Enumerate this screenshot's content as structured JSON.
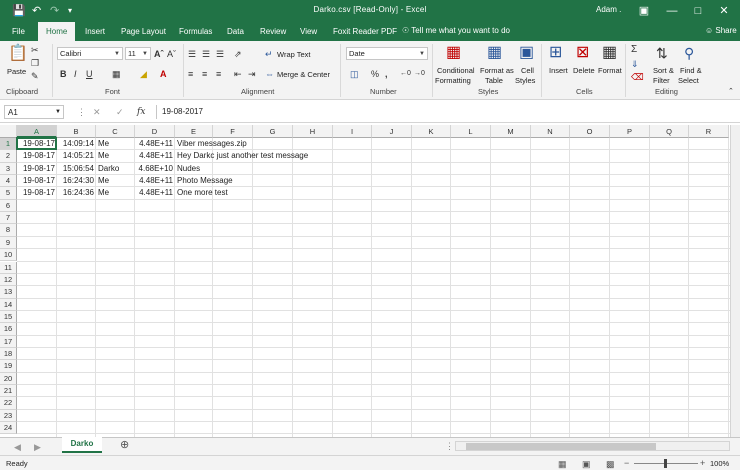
{
  "title_bar": {
    "title": "Darko.csv  [Read-Only]  -  Excel",
    "user": "Adam ."
  },
  "tabs": [
    "File",
    "Home",
    "Insert",
    "Page Layout",
    "Formulas",
    "Data",
    "Review",
    "View",
    "Foxit Reader PDF"
  ],
  "tell_me": "Tell me what you want to do",
  "share": "Share",
  "ribbon": {
    "clipboard": {
      "label": "Clipboard",
      "paste": "Paste"
    },
    "font": {
      "label": "Font",
      "name": "Calibri",
      "size": "11"
    },
    "alignment": {
      "label": "Alignment",
      "wrap": "Wrap Text",
      "merge": "Merge & Center"
    },
    "number": {
      "label": "Number",
      "format": "Date"
    },
    "styles": {
      "label": "Styles",
      "conditional_1": "Conditional",
      "conditional_2": "Formatting",
      "format_as_1": "Format as",
      "format_as_2": "Table",
      "cell_1": "Cell",
      "cell_2": "Styles"
    },
    "cells": {
      "label": "Cells",
      "insert": "Insert",
      "delete": "Delete",
      "format": "Format"
    },
    "editing": {
      "label": "Editing",
      "sort_1": "Sort &",
      "sort_2": "Filter",
      "find_1": "Find &",
      "find_2": "Select"
    }
  },
  "formula_bar": {
    "name_box": "A1",
    "fx": "fx",
    "value": "19-08-2017"
  },
  "columns": [
    "A",
    "B",
    "C",
    "D",
    "E",
    "F",
    "G",
    "H",
    "I",
    "J",
    "K",
    "L",
    "M",
    "N",
    "O",
    "P",
    "Q",
    "R"
  ],
  "rows": [
    "1",
    "2",
    "3",
    "4",
    "5",
    "6",
    "7",
    "8",
    "9",
    "10",
    "11",
    "12",
    "13",
    "14",
    "15",
    "16",
    "17",
    "18",
    "19",
    "20",
    "21",
    "22",
    "23",
    "24"
  ],
  "data": [
    [
      "19-08-17",
      "14:09:14",
      "Me",
      "4.48E+11",
      "Viber messages.zip"
    ],
    [
      "19-08-17",
      "14:05:21",
      "Me",
      "4.48E+11",
      "Hey Darkc  just another test message"
    ],
    [
      "19-08-17",
      "15:06:54",
      "Darko",
      "4.68E+10",
      "Nudes"
    ],
    [
      "19-08-17",
      "16:24:30",
      "Me",
      "4.48E+11",
      "Photo Message"
    ],
    [
      "19-08-17",
      "16:24:36",
      "Me",
      "4.48E+11",
      "One more test"
    ]
  ],
  "sheet_tab": "Darko",
  "status": {
    "ready": "Ready",
    "zoom": "100%"
  }
}
